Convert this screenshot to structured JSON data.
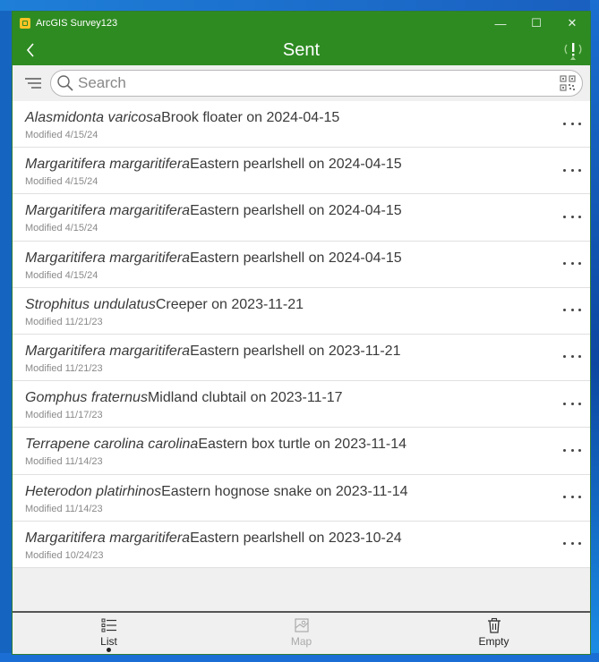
{
  "window": {
    "title": "ArcGIS Survey123",
    "minimize": "—",
    "maximize": "☐",
    "close": "✕"
  },
  "header": {
    "title": "Sent"
  },
  "search": {
    "placeholder": "Search",
    "value": ""
  },
  "items": [
    {
      "scientific": "Alasmidonta varicosa",
      "common": "Brook floater on 2024-04-15",
      "modified": "Modified 4/15/24"
    },
    {
      "scientific": "Margaritifera margaritifera",
      "common": "Eastern pearlshell on 2024-04-15",
      "modified": "Modified 4/15/24"
    },
    {
      "scientific": "Margaritifera margaritifera",
      "common": "Eastern pearlshell on 2024-04-15",
      "modified": "Modified 4/15/24"
    },
    {
      "scientific": "Margaritifera margaritifera",
      "common": "Eastern pearlshell on 2024-04-15",
      "modified": "Modified 4/15/24"
    },
    {
      "scientific": "Strophitus undulatus",
      "common": "Creeper on 2023-11-21",
      "modified": "Modified 11/21/23"
    },
    {
      "scientific": "Margaritifera margaritifera",
      "common": "Eastern pearlshell on 2023-11-21",
      "modified": "Modified 11/21/23"
    },
    {
      "scientific": "Gomphus fraternus",
      "common": "Midland clubtail on 2023-11-17",
      "modified": "Modified 11/17/23"
    },
    {
      "scientific": "Terrapene carolina carolina",
      "common": "Eastern box turtle on 2023-11-14",
      "modified": "Modified 11/14/23"
    },
    {
      "scientific": "Heterodon platirhinos",
      "common": "Eastern hognose snake on 2023-11-14",
      "modified": "Modified 11/14/23"
    },
    {
      "scientific": "Margaritifera margaritifera",
      "common": "Eastern pearlshell on 2023-10-24",
      "modified": "Modified 10/24/23"
    }
  ],
  "bottom": {
    "list_label": "List",
    "map_label": "Map",
    "empty_label": "Empty"
  },
  "colors": {
    "header": "#2e8b22",
    "accent_icon": "#f7c325"
  }
}
